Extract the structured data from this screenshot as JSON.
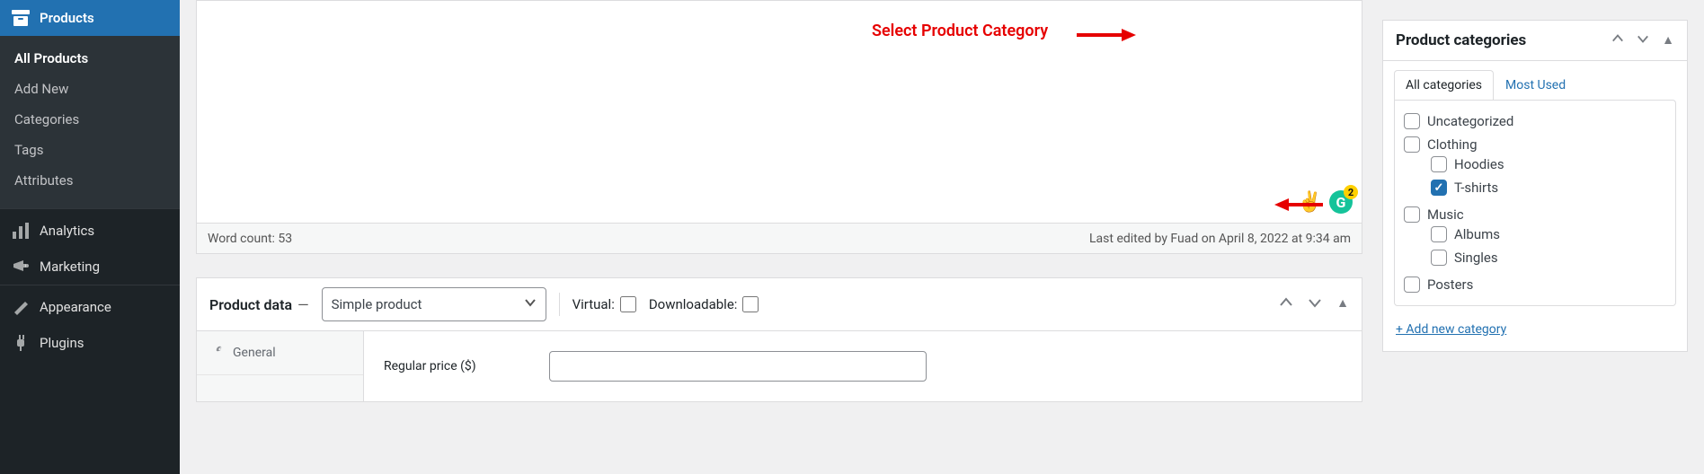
{
  "sidebar": {
    "current": {
      "label": "Products"
    },
    "submenu": [
      "All Products",
      "Add New",
      "Categories",
      "Tags",
      "Attributes"
    ],
    "items": [
      {
        "key": "analytics",
        "label": "Analytics"
      },
      {
        "key": "marketing",
        "label": "Marketing"
      },
      {
        "key": "appearance",
        "label": "Appearance"
      },
      {
        "key": "plugins",
        "label": "Plugins"
      }
    ]
  },
  "editor": {
    "word_count_label": "Word count: 53",
    "last_edited": "Last edited by Fuad on April 8, 2022 at 9:34 am",
    "peace_emoji": "✌️",
    "grammarly_badge": "2",
    "grammarly_glyph": "G"
  },
  "product_data": {
    "title": "Product data",
    "dash": "—",
    "type": "Simple product",
    "virtual_label": "Virtual:",
    "downloadable_label": "Downloadable:",
    "virtual": false,
    "downloadable": false,
    "tabs": {
      "general": "General"
    },
    "regular_price_label": "Regular price ($)",
    "regular_price_value": ""
  },
  "categories": {
    "title": "Product categories",
    "tabs": {
      "all": "All categories",
      "most_used": "Most Used"
    },
    "items": [
      {
        "label": "Uncategorized",
        "checked": false
      },
      {
        "label": "Clothing",
        "checked": false,
        "children": [
          {
            "label": "Hoodies",
            "checked": false
          },
          {
            "label": "T-shirts",
            "checked": true
          }
        ]
      },
      {
        "label": "Music",
        "checked": false,
        "children": [
          {
            "label": "Albums",
            "checked": false
          },
          {
            "label": "Singles",
            "checked": false
          }
        ]
      },
      {
        "label": "Posters",
        "checked": false
      }
    ],
    "add_link": "+ Add new category"
  },
  "annotation": {
    "label": "Select Product Category"
  },
  "icons": {
    "chevron_up": "▴",
    "chevron_down": "▾",
    "triangle_up": "▲",
    "check": "✓"
  }
}
